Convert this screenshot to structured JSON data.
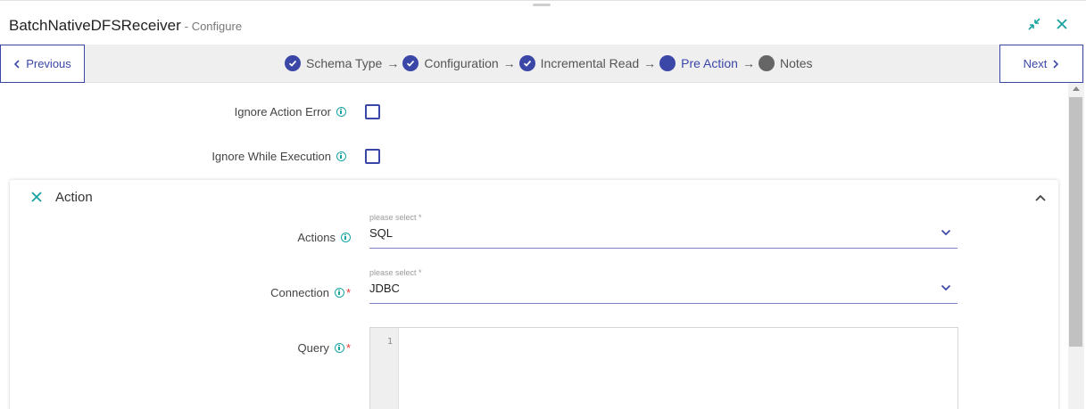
{
  "header": {
    "title": "BatchNativeDFSReceiver",
    "subtitle": "- Configure"
  },
  "wizard": {
    "previous_label": "Previous",
    "next_label": "Next",
    "steps": [
      {
        "label": "Schema Type",
        "state": "done"
      },
      {
        "label": "Configuration",
        "state": "done"
      },
      {
        "label": "Incremental Read",
        "state": "done"
      },
      {
        "label": "Pre Action",
        "state": "active"
      },
      {
        "label": "Notes",
        "state": "pending"
      }
    ],
    "arrow": "→"
  },
  "form": {
    "ignore_action_error": {
      "label": "Ignore Action Error",
      "checked": false
    },
    "ignore_while_execution": {
      "label": "Ignore While Execution",
      "checked": false
    }
  },
  "action_panel": {
    "title": "Action",
    "actions": {
      "label": "Actions",
      "hint": "please select *",
      "value": "SQL"
    },
    "connection": {
      "label": "Connection",
      "required": "*",
      "hint": "please select *",
      "value": "JDBC"
    },
    "query": {
      "label": "Query",
      "required": "*",
      "line_number": "1"
    }
  },
  "colors": {
    "accent": "#3b47a7",
    "info": "#17a2a2",
    "required": "#e53935"
  }
}
